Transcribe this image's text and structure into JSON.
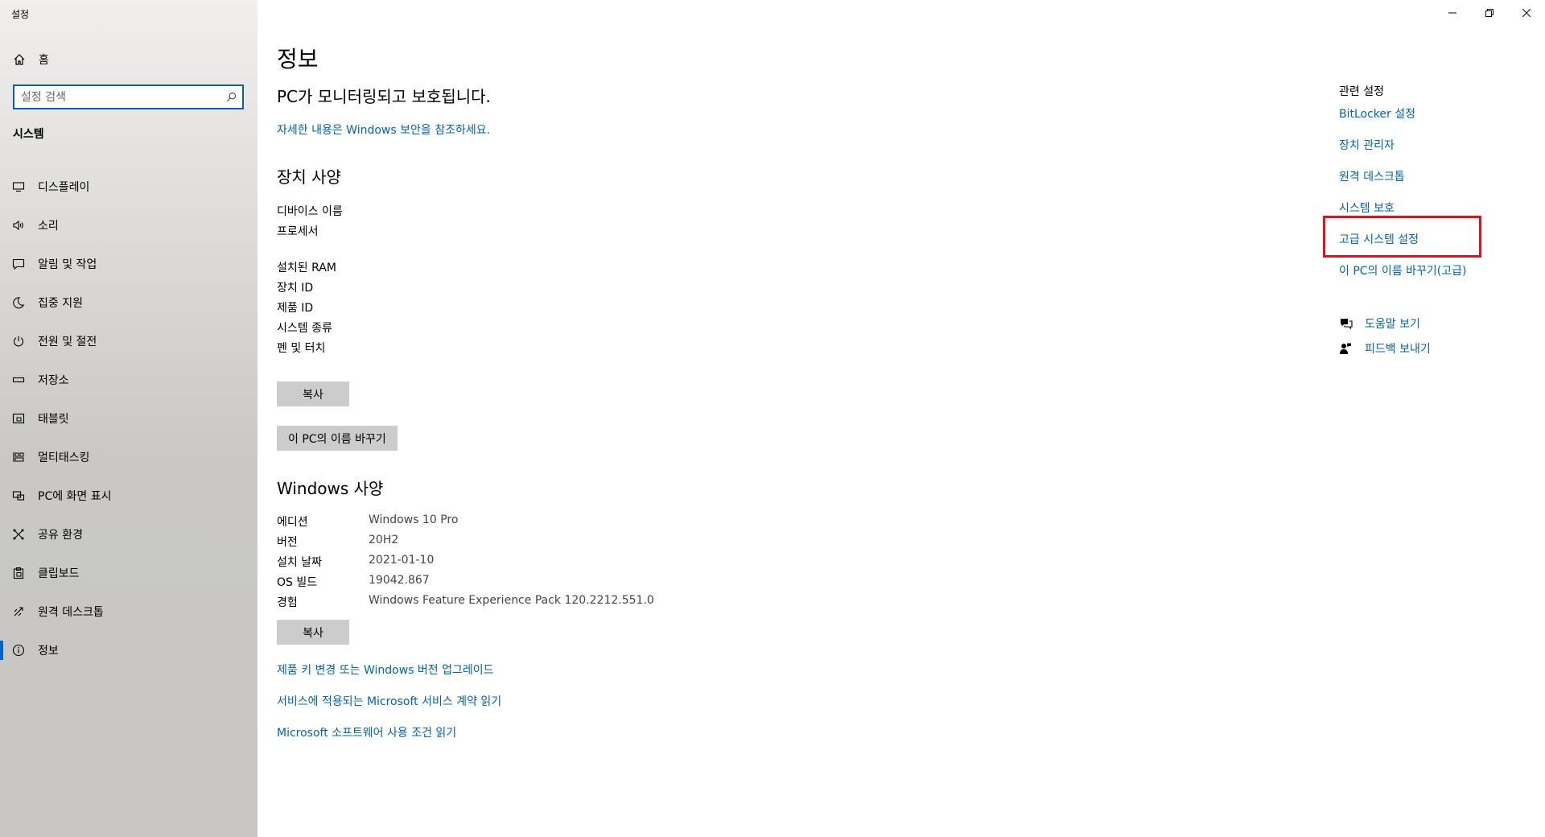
{
  "app": {
    "title": "설정"
  },
  "window_controls": {
    "minimize": "—",
    "maximize": "❐",
    "close": "✕"
  },
  "sidebar": {
    "home_label": "홈",
    "search_placeholder": "설정 검색",
    "section": "시스템",
    "items": [
      {
        "label": "디스플레이",
        "icon": "display-icon"
      },
      {
        "label": "소리",
        "icon": "sound-icon"
      },
      {
        "label": "알림 및 작업",
        "icon": "notification-icon"
      },
      {
        "label": "집중 지원",
        "icon": "focus-moon-icon"
      },
      {
        "label": "전원 및 절전",
        "icon": "power-icon"
      },
      {
        "label": "저장소",
        "icon": "storage-icon"
      },
      {
        "label": "태블릿",
        "icon": "tablet-icon"
      },
      {
        "label": "멀티태스킹",
        "icon": "multitasking-icon"
      },
      {
        "label": "PC에 화면 표시",
        "icon": "project-icon"
      },
      {
        "label": "공유 환경",
        "icon": "shared-experiences-icon"
      },
      {
        "label": "클립보드",
        "icon": "clipboard-icon"
      },
      {
        "label": "원격 데스크톱",
        "icon": "remote-desktop-icon"
      },
      {
        "label": "정보",
        "icon": "info-icon",
        "active": true
      }
    ]
  },
  "main": {
    "title": "정보",
    "protected_text": "PC가 모니터링되고 보호됩니다.",
    "security_link": "자세한 내용은 Windows 보안을 참조하세요.",
    "device_specs_title": "장치 사양",
    "device_specs": [
      {
        "key": "디바이스 이름",
        "value": ""
      },
      {
        "key": "프로세서",
        "value": ""
      },
      {
        "key": "설치된 RAM",
        "value": ""
      },
      {
        "key": "장치 ID",
        "value": ""
      },
      {
        "key": "제품 ID",
        "value": ""
      },
      {
        "key": "시스템 종류",
        "value": ""
      },
      {
        "key": "펜 및 터치",
        "value": ""
      }
    ],
    "copy_button": "복사",
    "rename_button": "이 PC의 이름 바꾸기",
    "windows_specs_title": "Windows 사양",
    "windows_specs": [
      {
        "key": "에디션",
        "value": "Windows 10 Pro"
      },
      {
        "key": "버전",
        "value": "20H2"
      },
      {
        "key": "설치 날짜",
        "value": "2021-01-10"
      },
      {
        "key": "OS 빌드",
        "value": "19042.867"
      },
      {
        "key": "경험",
        "value": "Windows Feature Experience Pack 120.2212.551.0"
      }
    ],
    "copy_button_2": "복사",
    "links": [
      "제품 키 변경 또는 Windows 버전 업그레이드",
      "서비스에 적용되는 Microsoft 서비스 계약 읽기",
      "Microsoft 소프트웨어 사용 조건 읽기"
    ]
  },
  "related": {
    "title": "관련 설정",
    "links": [
      "BitLocker 설정",
      "장치 관리자",
      "원격 데스크톱",
      "시스템 보호",
      "고급 시스템 설정",
      "이 PC의 이름 바꾸기(고급)"
    ],
    "help_label": "도움말 보기",
    "feedback_label": "피드백 보내기"
  },
  "colors": {
    "accent": "#0063b1",
    "highlight": "#e0101e",
    "button": "#cccccc"
  }
}
